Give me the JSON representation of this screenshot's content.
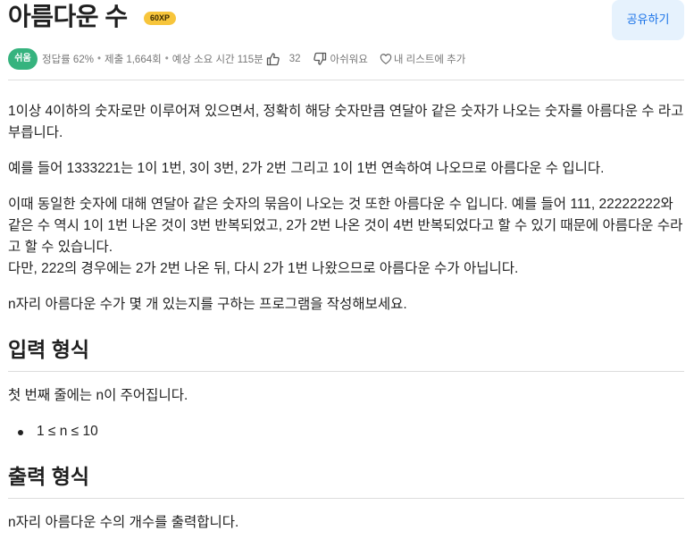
{
  "problem": {
    "title": "아름다운 수",
    "xp": "60XP",
    "share_label": "공유하기"
  },
  "meta": {
    "difficulty": "쉬움",
    "accuracy": "정답률 62%",
    "submissions": "제출 1,664회",
    "estimated_time": "예상 소요 시간 115분",
    "likes": "32",
    "dislike_label": "아쉬워요",
    "add_list_label": "내 리스트에 추가",
    "icons": [
      "thumbs-up-icon",
      "thumbs-down-icon",
      "heart-icon"
    ]
  },
  "description": {
    "p1": "1이상 4이하의 숫자로만 이루어져 있으면서, 정확히 해당 숫자만큼 연달아 같은 숫자가 나오는 숫자를 아름다운 수 라고 부릅니다.",
    "p2": "예를 들어 1333221는 1이 1번, 3이 3번, 2가 2번 그리고 1이 1번 연속하여 나오므로 아름다운 수 입니다.",
    "p3": "이때 동일한 숫자에 대해 연달아 같은 숫자의 묶음이 나오는 것 또한 아름다운 수 입니다. 예를 들어 111, 22222222와 같은 수 역시 1이 1번 나온 것이 3번 반복되었고, 2가 2번 나온 것이 4번 반복되었다고 할 수 있기 때문에 아름다운 수라고 할 수 있습니다.",
    "p4": "다만, 222의 경우에는 2가 2번 나온 뒤, 다시 2가 1번 나왔으므로 아름다운 수가 아닙니다.",
    "p5": "n자리 아름다운 수가 몇 개 있는지를 구하는 프로그램을 작성해보세요."
  },
  "input_section": {
    "heading": "입력 형식",
    "text": "첫 번째 줄에는 n이 주어집니다.",
    "constraint": "1 ≤ n ≤ 10"
  },
  "output_section": {
    "heading": "출력 형식",
    "text": "n자리 아름다운 수의 개수를 출력합니다."
  }
}
